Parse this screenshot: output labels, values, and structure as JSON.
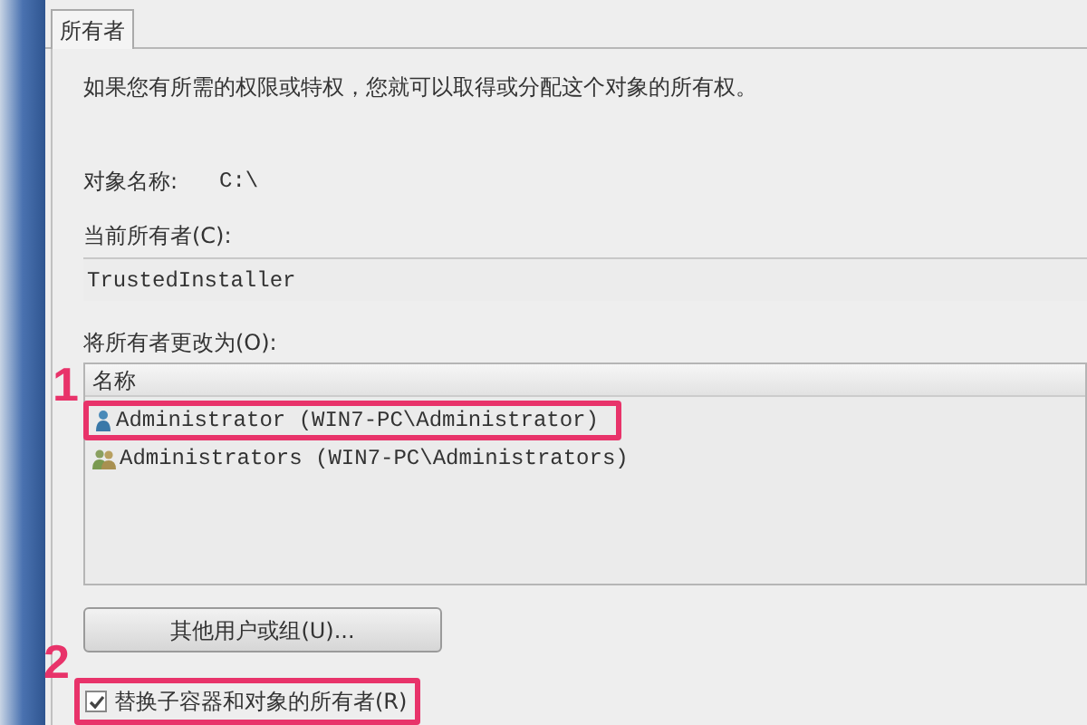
{
  "tabs": [
    {
      "label": "所有者",
      "selected": true
    }
  ],
  "description": "如果您有所需的权限或特权，您就可以取得或分配这个对象的所有权。",
  "object_name": {
    "label": "对象名称:",
    "value": "C:\\"
  },
  "current_owner": {
    "label": "当前所有者(C):",
    "value": "TrustedInstaller"
  },
  "change_owner": {
    "label": "将所有者更改为(O):",
    "column": "名称",
    "items": [
      {
        "kind": "user",
        "text": "Administrator (WIN7-PC\\Administrator)",
        "highlighted": true,
        "callout": "1"
      },
      {
        "kind": "group",
        "text": "Administrators (WIN7-PC\\Administrators)",
        "highlighted": false
      }
    ]
  },
  "other_button": "其他用户或组(U)...",
  "replace_checkbox": {
    "label": "替换子容器和对象的所有者(R)",
    "checked": true,
    "highlighted": true,
    "callout": "2"
  }
}
